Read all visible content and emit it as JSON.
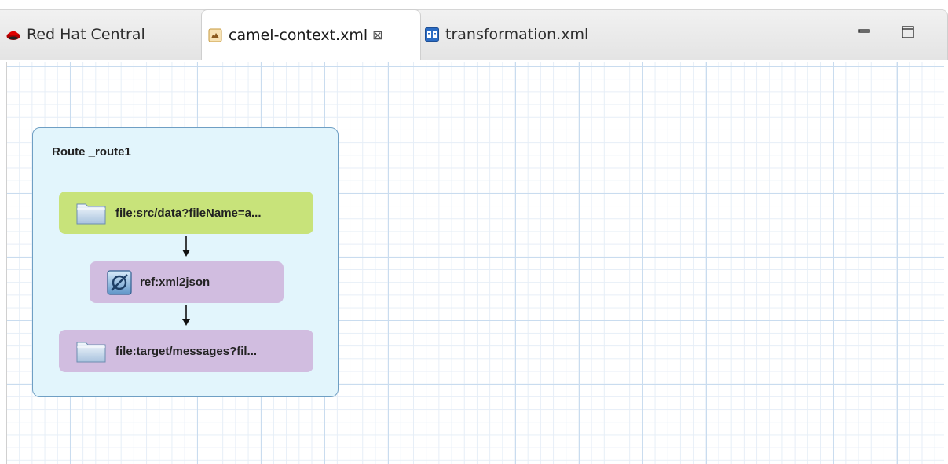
{
  "tabs": [
    {
      "label": "Red Hat Central",
      "icon": "redhat-icon"
    },
    {
      "label": "camel-context.xml",
      "icon": "camel-file-icon",
      "active": true,
      "close_glyph": "⊠"
    },
    {
      "label": "transformation.xml",
      "icon": "data-mapper-icon"
    }
  ],
  "window": {
    "minimize_icon": "minimize-icon",
    "maximize_icon": "maximize-icon"
  },
  "route": {
    "title": "Route _route1",
    "nodes": [
      {
        "label": "file:src/data?fileName=a...",
        "icon": "folder-icon",
        "color": "#c8e37a"
      },
      {
        "label": "ref:xml2json",
        "icon": "transform-icon",
        "color": "#d1bde0"
      },
      {
        "label": "file:target/messages?fil...",
        "icon": "folder-icon",
        "color": "#d1bde0"
      }
    ]
  },
  "colors": {
    "route_bg": "#e2f5fc",
    "route_border": "#6f9fc4",
    "grid": "#c9dcef"
  }
}
